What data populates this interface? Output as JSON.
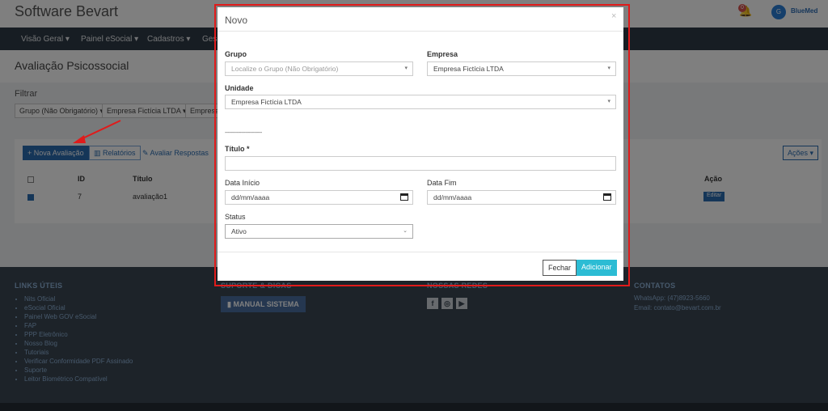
{
  "app": {
    "brand": "Software Bevart",
    "notif_count": "0",
    "user_initial": "G",
    "user_logo": "BlueMed"
  },
  "nav": [
    "Visão Geral ▾",
    "Painel eSocial ▾",
    "Cadastros ▾",
    "Ges"
  ],
  "page": {
    "title": "Avaliação Psicossocial",
    "filter_label": "Filtrar",
    "filters": [
      "Grupo (Não Obrigatório) ▾",
      "Empresa Fictícia LTDA ▾",
      "Empresa"
    ],
    "toolbar": {
      "new": "+ Nova Avaliação",
      "reports": "Relatórios",
      "evaluate": "Avaliar Respostas",
      "actions": "Ações ▾"
    },
    "table": {
      "headers": {
        "id": "ID",
        "title": "Título",
        "action": "Ação"
      },
      "rows": [
        {
          "id": "7",
          "title": "avaliação1",
          "edit": "Editar"
        }
      ]
    }
  },
  "footer": {
    "links_title": "LINKS ÚTEIS",
    "links": [
      "Nits Oficial",
      "eSocial Oficial",
      "Painel Web GOV eSocial",
      "FAP",
      "PPP Eletrônico",
      "Nosso Blog",
      "Tutoriais",
      "Verificar Conformidade PDF Assinado",
      "Suporte",
      "Leitor Biométrico Compatível"
    ],
    "col2_title": "SUPORTE & DICAS",
    "manual": "MANUAL SISTEMA",
    "col3_title": "NOSSAS REDES",
    "contact_title": "CONTATOS",
    "whatsapp": "WhatsApp: (47)8923-5660",
    "email": "Email: contato@bevart.com.br"
  },
  "modal": {
    "title": "Novo",
    "close": "×",
    "grupo_label": "Grupo",
    "grupo_placeholder": "Localize o Grupo (Não Obrigatório)",
    "empresa_label": "Empresa",
    "empresa_value": "Empresa Fictícia LTDA",
    "unidade_label": "Unidade",
    "unidade_value": "Empresa Fictícia LTDA",
    "divider": "-------------------------",
    "titulo_label": "Título *",
    "data_inicio_label": "Data Início",
    "data_inicio_placeholder": "dd/mm/aaaa",
    "data_fim_label": "Data Fim",
    "data_fim_placeholder": "dd/mm/aaaa",
    "status_label": "Status",
    "status_value": "Ativo",
    "close_button": "Fechar",
    "add_button": "Adicionar"
  },
  "colors": {
    "highlight": "#e01b1b",
    "primary": "#2b6cb0",
    "add_button": "#2cbcd4",
    "navbar": "#2f3b46",
    "footer": "#3a4652"
  }
}
